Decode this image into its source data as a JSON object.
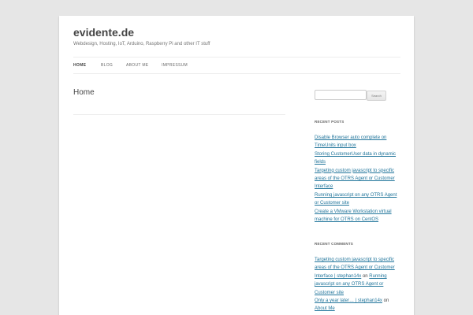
{
  "site": {
    "title": "evidente.de",
    "description": "Webdesign, Hosting, IoT, Arduino, Raspberry Pi and other IT stuff"
  },
  "nav": {
    "items": [
      {
        "label": "HOME",
        "active": true
      },
      {
        "label": "BLOG",
        "active": false
      },
      {
        "label": "ABOUT ME",
        "active": false
      },
      {
        "label": "IMPRESSUM",
        "active": false
      }
    ]
  },
  "main": {
    "page_title": "Home"
  },
  "sidebar": {
    "search": {
      "value": "",
      "button_label": "Search"
    },
    "recent_posts": {
      "title": "RECENT POSTS",
      "items": [
        "Disable Browser auto complete on TimeUnits input box",
        "Storing CustomerUser data in dynamic fields",
        "Targeting custom javascript to specific areas of the OTRS Agent or Customer Interface",
        "Running javascript on any OTRS Agent or Customer site",
        "Create a VMware Workstation virtual machine for OTRS on CentOS"
      ]
    },
    "recent_comments": {
      "title": "RECENT COMMENTS",
      "items": [
        {
          "author": "Targeting custom javascript to specific areas of the OTRS Agent or Customer Interface | stephan14x",
          "on_label": "on",
          "post": "Running javascript on any OTRS Agent or Customer site"
        },
        {
          "author": "Only a year later… | stephan14x",
          "on_label": "on",
          "post": "About Me"
        }
      ]
    }
  },
  "colors": {
    "background": "#e6e6e6",
    "link": "#21759b",
    "text": "#444444"
  }
}
